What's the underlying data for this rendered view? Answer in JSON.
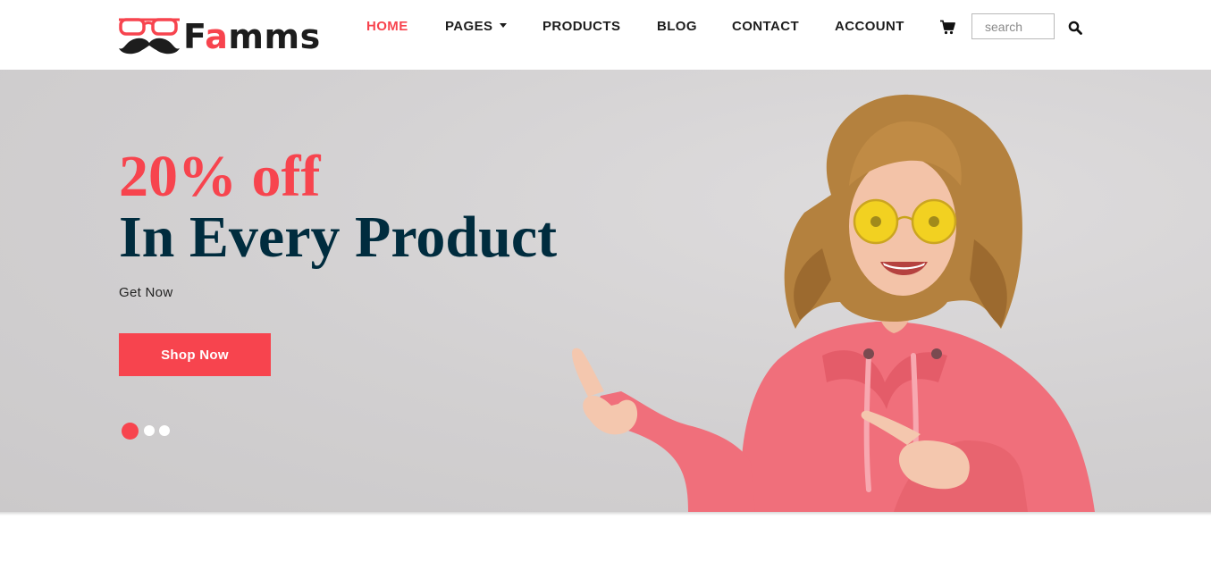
{
  "brand": {
    "name_prefix": "F",
    "name_accent": "a",
    "name_suffix": "mms",
    "accent_color": "#f7444e",
    "dark_color": "#1d1d1d"
  },
  "nav": {
    "items": [
      {
        "label": "HOME",
        "active": true
      },
      {
        "label": "PAGES",
        "dropdown": true
      },
      {
        "label": "PRODUCTS"
      },
      {
        "label": "BLOG"
      },
      {
        "label": "CONTACT"
      },
      {
        "label": "ACCOUNT"
      }
    ],
    "cart_icon": "cart-icon",
    "search_placeholder": "search",
    "search_icon": "search-icon"
  },
  "hero": {
    "discount": "20% off",
    "title": "In Every Product",
    "subtitle": "Get Now",
    "button_label": "Shop Now",
    "title_color": "#002c3e",
    "slides": {
      "count": 3,
      "active_index": 0
    }
  }
}
